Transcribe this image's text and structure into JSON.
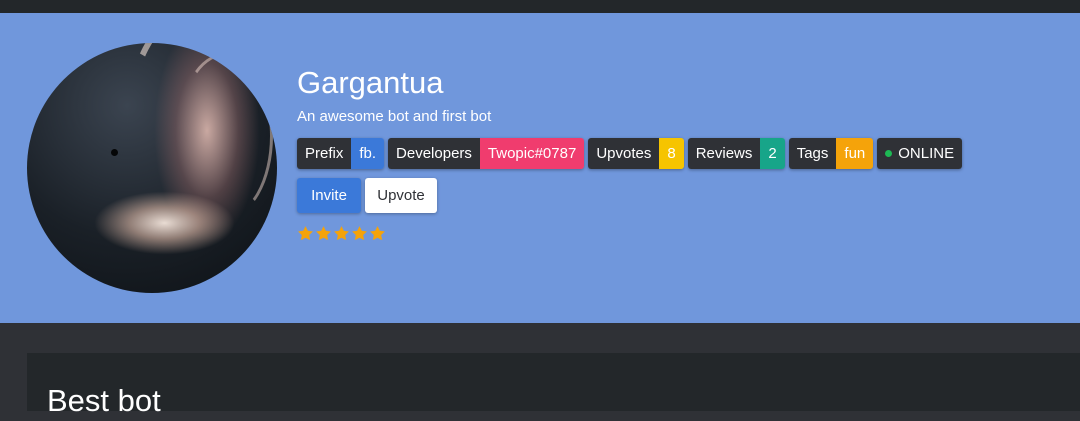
{
  "bot": {
    "name": "Gargantua",
    "description": "An awesome bot and first bot",
    "avatar_alt": "Gargantua"
  },
  "badges": {
    "prefix": {
      "label": "Prefix",
      "value": "fb."
    },
    "developers": {
      "label": "Developers",
      "value": "Twopic#0787"
    },
    "upvotes": {
      "label": "Upvotes",
      "value": "8"
    },
    "reviews": {
      "label": "Reviews",
      "value": "2"
    },
    "tags": {
      "label": "Tags",
      "value": "fun"
    },
    "status": {
      "label": "ONLINE",
      "indicator_color": "#1db954"
    }
  },
  "actions": {
    "invite_label": "Invite",
    "upvote_label": "Upvote"
  },
  "rating": {
    "stars": 5,
    "max": 5,
    "star_color": "#f5a30a"
  },
  "review_section": {
    "title": "Best bot"
  },
  "colors": {
    "hero_bg": "#7097dc",
    "page_bg": "#2f3136",
    "accent_blue": "#3b79d9",
    "developer_pink": "#f03c6e",
    "upvotes_yellow": "#f6c400",
    "reviews_green": "#17a589",
    "tags_orange": "#f5a30a"
  }
}
